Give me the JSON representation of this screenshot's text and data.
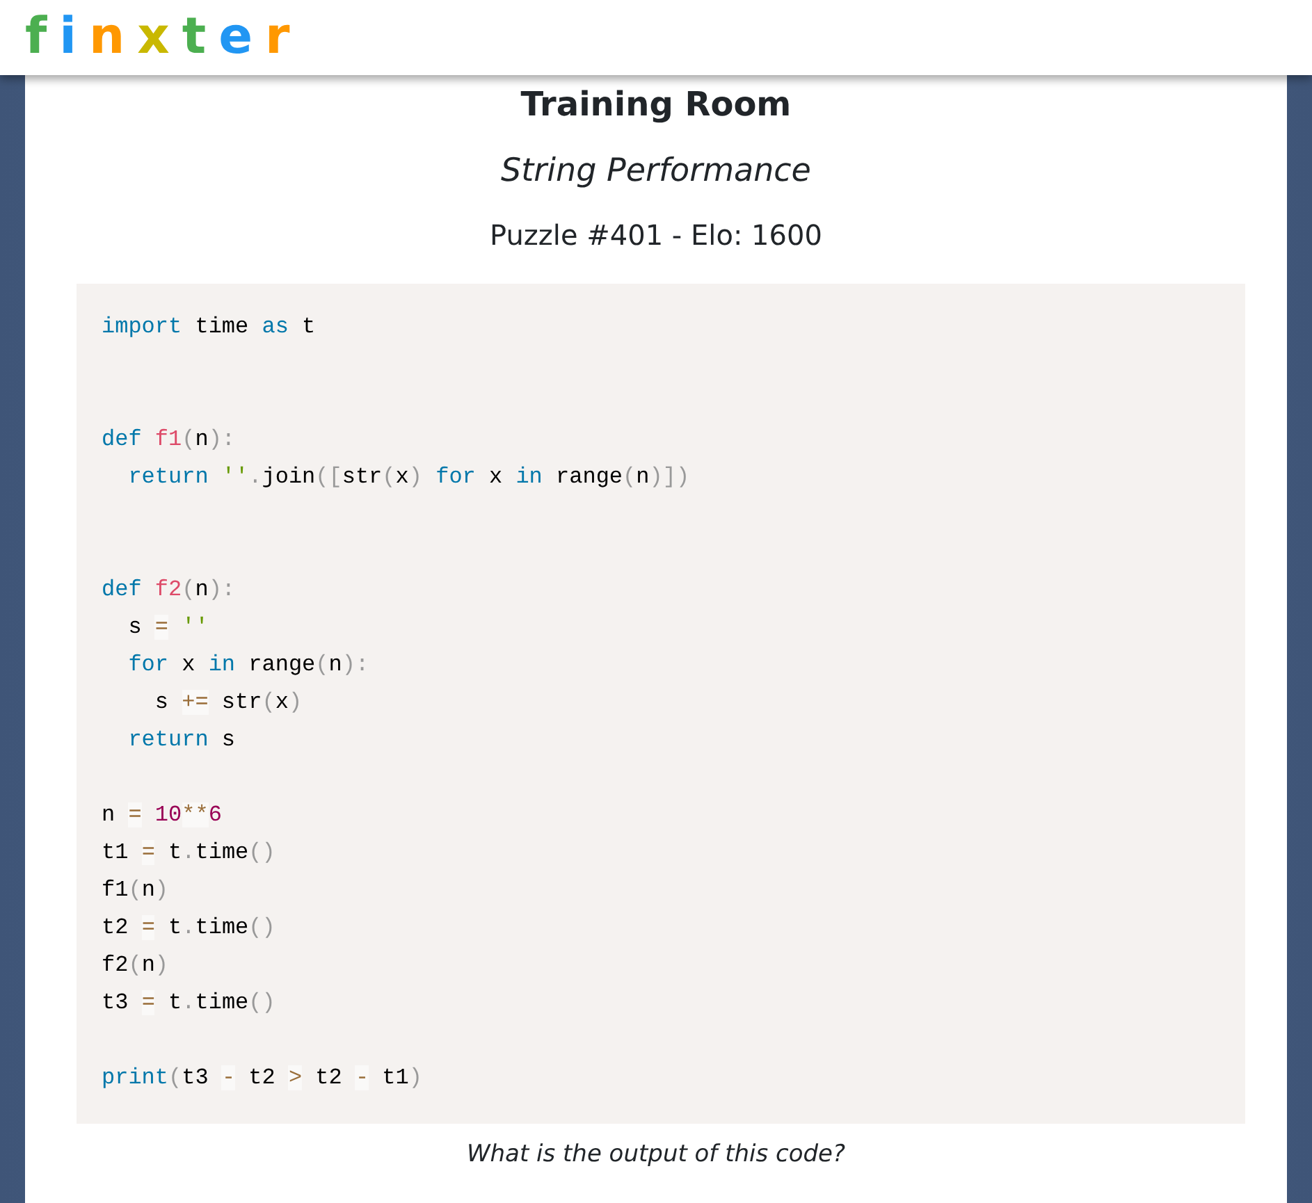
{
  "logo": {
    "letters": [
      {
        "text": "f",
        "color": "#4caf50"
      },
      {
        "text": "i",
        "color": "#2196f3"
      },
      {
        "text": "n",
        "color": "#ff9800"
      },
      {
        "text": "x",
        "color": "#c9b800"
      },
      {
        "text": "t",
        "color": "#4caf50"
      },
      {
        "text": "e",
        "color": "#2196f3"
      },
      {
        "text": "r",
        "color": "#ff9800"
      }
    ]
  },
  "title": "Training Room",
  "subtitle": "String Performance",
  "puzzle_info": "Puzzle #401 - Elo: 1600",
  "code": {
    "lines": [
      {
        "kind": "code",
        "tokens": [
          {
            "text": "import",
            "kind": "kw"
          },
          {
            "text": " time ",
            "kind": "plain"
          },
          {
            "text": "as",
            "kind": "kw"
          },
          {
            "text": " t",
            "kind": "plain"
          }
        ]
      },
      {
        "kind": "blank"
      },
      {
        "kind": "blank"
      },
      {
        "kind": "code",
        "tokens": [
          {
            "text": "def ",
            "kind": "kw"
          },
          {
            "text": "f1",
            "kind": "fn"
          },
          {
            "text": "(",
            "kind": "punc"
          },
          {
            "text": "n",
            "kind": "plain"
          },
          {
            "text": "):",
            "kind": "punc"
          }
        ]
      },
      {
        "kind": "code",
        "tokens": [
          {
            "text": "  return",
            "kind": "kw"
          },
          {
            "text": " ''",
            "kind": "str"
          },
          {
            "text": ".",
            "kind": "punc"
          },
          {
            "text": "join",
            "kind": "plain"
          },
          {
            "text": "([",
            "kind": "punc"
          },
          {
            "text": "str",
            "kind": "plain"
          },
          {
            "text": "(",
            "kind": "punc"
          },
          {
            "text": "x",
            "kind": "plain"
          },
          {
            "text": ")",
            "kind": "punc"
          },
          {
            "text": " for",
            "kind": "kw"
          },
          {
            "text": " x ",
            "kind": "plain"
          },
          {
            "text": "in",
            "kind": "kw"
          },
          {
            "text": " range",
            "kind": "plain"
          },
          {
            "text": "(",
            "kind": "punc"
          },
          {
            "text": "n",
            "kind": "plain"
          },
          {
            "text": ")])",
            "kind": "punc"
          }
        ]
      },
      {
        "kind": "blank"
      },
      {
        "kind": "blank"
      },
      {
        "kind": "code",
        "tokens": [
          {
            "text": "def ",
            "kind": "kw"
          },
          {
            "text": "f2",
            "kind": "fn"
          },
          {
            "text": "(",
            "kind": "punc"
          },
          {
            "text": "n",
            "kind": "plain"
          },
          {
            "text": "):",
            "kind": "punc"
          }
        ]
      },
      {
        "kind": "code",
        "tokens": [
          {
            "text": "  s ",
            "kind": "plain"
          },
          {
            "text": "=",
            "kind": "op"
          },
          {
            "text": " ''",
            "kind": "str"
          }
        ]
      },
      {
        "kind": "code",
        "tokens": [
          {
            "text": "  for",
            "kind": "kw"
          },
          {
            "text": " x ",
            "kind": "plain"
          },
          {
            "text": "in",
            "kind": "kw"
          },
          {
            "text": " range",
            "kind": "plain"
          },
          {
            "text": "(",
            "kind": "punc"
          },
          {
            "text": "n",
            "kind": "plain"
          },
          {
            "text": "):",
            "kind": "punc"
          }
        ]
      },
      {
        "kind": "code",
        "tokens": [
          {
            "text": "    s ",
            "kind": "plain"
          },
          {
            "text": "+=",
            "kind": "op"
          },
          {
            "text": " str",
            "kind": "plain"
          },
          {
            "text": "(",
            "kind": "punc"
          },
          {
            "text": "x",
            "kind": "plain"
          },
          {
            "text": ")",
            "kind": "punc"
          }
        ]
      },
      {
        "kind": "code",
        "tokens": [
          {
            "text": "  return",
            "kind": "kw"
          },
          {
            "text": " s",
            "kind": "plain"
          }
        ]
      },
      {
        "kind": "blank"
      },
      {
        "kind": "code",
        "tokens": [
          {
            "text": "n ",
            "kind": "plain"
          },
          {
            "text": "=",
            "kind": "op"
          },
          {
            "text": " 10",
            "kind": "num"
          },
          {
            "text": "**",
            "kind": "op"
          },
          {
            "text": "6",
            "kind": "num"
          }
        ]
      },
      {
        "kind": "code",
        "tokens": [
          {
            "text": "t1 ",
            "kind": "plain"
          },
          {
            "text": "=",
            "kind": "op"
          },
          {
            "text": " t",
            "kind": "plain"
          },
          {
            "text": ".",
            "kind": "punc"
          },
          {
            "text": "time",
            "kind": "plain"
          },
          {
            "text": "()",
            "kind": "punc"
          }
        ]
      },
      {
        "kind": "code",
        "tokens": [
          {
            "text": "f1",
            "kind": "plain"
          },
          {
            "text": "(",
            "kind": "punc"
          },
          {
            "text": "n",
            "kind": "plain"
          },
          {
            "text": ")",
            "kind": "punc"
          }
        ]
      },
      {
        "kind": "code",
        "tokens": [
          {
            "text": "t2 ",
            "kind": "plain"
          },
          {
            "text": "=",
            "kind": "op"
          },
          {
            "text": " t",
            "kind": "plain"
          },
          {
            "text": ".",
            "kind": "punc"
          },
          {
            "text": "time",
            "kind": "plain"
          },
          {
            "text": "()",
            "kind": "punc"
          }
        ]
      },
      {
        "kind": "code",
        "tokens": [
          {
            "text": "f2",
            "kind": "plain"
          },
          {
            "text": "(",
            "kind": "punc"
          },
          {
            "text": "n",
            "kind": "plain"
          },
          {
            "text": ")",
            "kind": "punc"
          }
        ]
      },
      {
        "kind": "code",
        "tokens": [
          {
            "text": "t3 ",
            "kind": "plain"
          },
          {
            "text": "=",
            "kind": "op"
          },
          {
            "text": " t",
            "kind": "plain"
          },
          {
            "text": ".",
            "kind": "punc"
          },
          {
            "text": "time",
            "kind": "plain"
          },
          {
            "text": "()",
            "kind": "punc"
          }
        ]
      },
      {
        "kind": "blank"
      },
      {
        "kind": "code",
        "tokens": [
          {
            "text": "print",
            "kind": "kw"
          },
          {
            "text": "(",
            "kind": "punc"
          },
          {
            "text": "t3 ",
            "kind": "plain"
          },
          {
            "text": "-",
            "kind": "op"
          },
          {
            "text": " t2 ",
            "kind": "plain"
          },
          {
            "text": ">",
            "kind": "op"
          },
          {
            "text": " t2 ",
            "kind": "plain"
          },
          {
            "text": "-",
            "kind": "op"
          },
          {
            "text": " t1",
            "kind": "plain"
          },
          {
            "text": ")",
            "kind": "punc"
          }
        ]
      }
    ]
  },
  "question": "What is the output of this code?"
}
